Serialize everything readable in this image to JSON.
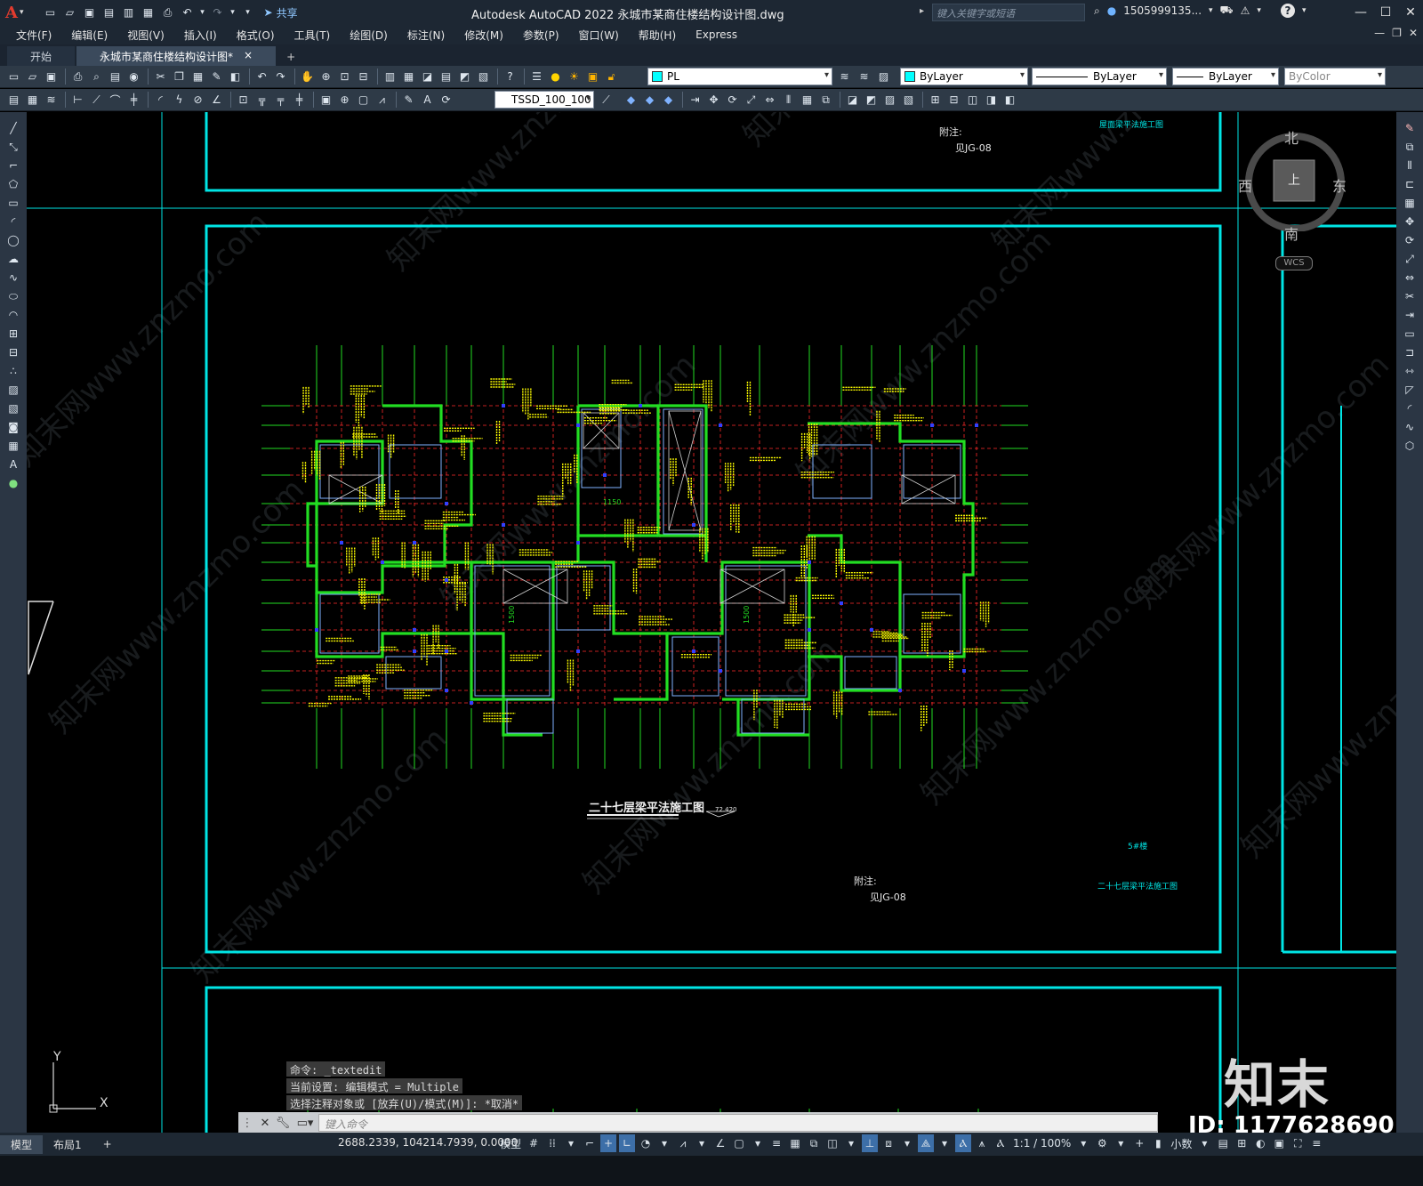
{
  "app": {
    "logo": "A",
    "share": "共享",
    "title": "Autodesk AutoCAD 2022    永城市某商住楼结构设计图.dwg",
    "search_placeholder": "键入关键字或短语",
    "user": "1505999135...",
    "help": "?"
  },
  "menu": [
    "文件(F)",
    "编辑(E)",
    "视图(V)",
    "插入(I)",
    "格式(O)",
    "工具(T)",
    "绘图(D)",
    "标注(N)",
    "修改(M)",
    "参数(P)",
    "窗口(W)",
    "帮助(H)",
    "Express"
  ],
  "tabs": {
    "start": "开始",
    "active": "永城市某商住楼结构设计图*",
    "close": "×",
    "add": "+"
  },
  "toolbar1": {
    "layer": "PL",
    "color": "ByLayer",
    "linetype": "ByLayer",
    "lineweight": "ByLayer",
    "plotstyle": "ByColor"
  },
  "toolbar2": {
    "textstyle": "TSSD_100_100"
  },
  "drawing": {
    "top_note_label": "附注:",
    "top_note_ref": "见JG-08",
    "top_cyan_title": "屋面梁平法施工图",
    "plan_title": "二十七层梁平法施工图",
    "plan_elevation": "72.420",
    "building_no": "5#楼",
    "note_label": "附注:",
    "note_ref": "见JG-08",
    "cyan_title": "二十七层梁平法施工图",
    "dim_1150": "1150",
    "dim_1500a": "1500",
    "dim_1500b": "1500"
  },
  "compass": {
    "north": "北",
    "south": "南",
    "east": "东",
    "west": "西",
    "top": "上",
    "wcs": "WCS"
  },
  "ucs": {
    "y": "Y",
    "x": "X"
  },
  "command": {
    "history": [
      "命令: _textedit",
      "当前设置: 编辑模式 = Multiple",
      "选择注释对象或 [放弃(U)/模式(M)]: *取消*"
    ],
    "placeholder": "键入命令"
  },
  "watermark": {
    "logo": "知末",
    "id": "ID: 1177628690",
    "tile_text": "知末网www.znzmo.com"
  },
  "status": {
    "tab_model": "模型",
    "tab_layout": "布局1",
    "tab_add": "+",
    "coords": "2688.2339, 104214.7939, 0.0000",
    "space": "模型",
    "scale": "1:1 / 100%",
    "units": "小数"
  },
  "colors": {
    "frame_cyan": "#00e5e5",
    "grid_red": "#ff2a2a",
    "wall_green": "#22dd22",
    "text_yellow": "#ffff00",
    "beam_blue": "#7fb2ff"
  }
}
